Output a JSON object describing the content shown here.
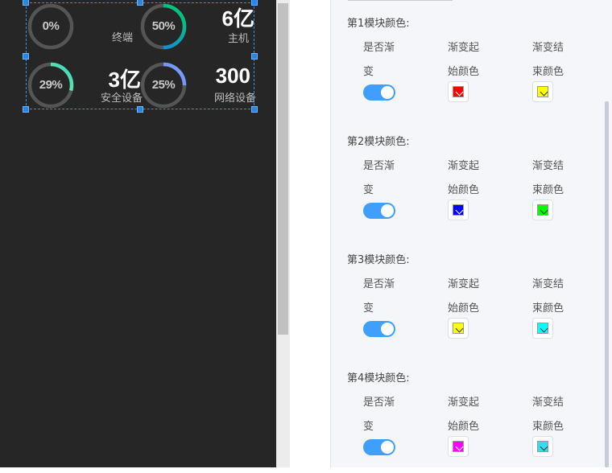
{
  "canvas": {
    "rings": [
      {
        "label": "0%",
        "percent": 0,
        "color_start": "#00d26a",
        "color_end": "#00d26a"
      },
      {
        "label": "50%",
        "percent": 50,
        "color_start": "#1e6fff",
        "color_end": "#00d26a"
      },
      {
        "label": "29%",
        "percent": 29,
        "color_start": "#b6ff5b",
        "color_end": "#36d6c8"
      },
      {
        "label": "25%",
        "percent": 25,
        "color_start": "#9b4dff",
        "color_end": "#6fa8ff"
      }
    ],
    "stats": [
      {
        "value": "6亿",
        "label": "主机"
      },
      {
        "value": "3亿",
        "label": "安全设备"
      },
      {
        "value": "300",
        "label": "网络设备"
      }
    ],
    "terminal_label": "终端"
  },
  "panel": {
    "col_headers": {
      "gradient_line1": "是否渐",
      "gradient_line2": "变",
      "start_line1": "渐变起",
      "start_line2": "始颜色",
      "end_line1": "渐变结",
      "end_line2": "束颜色"
    },
    "blocks": [
      {
        "title": "第1模块颜色:",
        "gradient_on": true,
        "start_color": "#ff0000",
        "end_color": "#ffff00"
      },
      {
        "title": "第2模块颜色:",
        "gradient_on": true,
        "start_color": "#0000ff",
        "end_color": "#00ff00"
      },
      {
        "title": "第3模块颜色:",
        "gradient_on": true,
        "start_color": "#ffff00",
        "end_color": "#00ffff"
      },
      {
        "title": "第4模块颜色:",
        "gradient_on": true,
        "start_color": "#ff00ff",
        "end_color": "#33ddee"
      }
    ]
  }
}
